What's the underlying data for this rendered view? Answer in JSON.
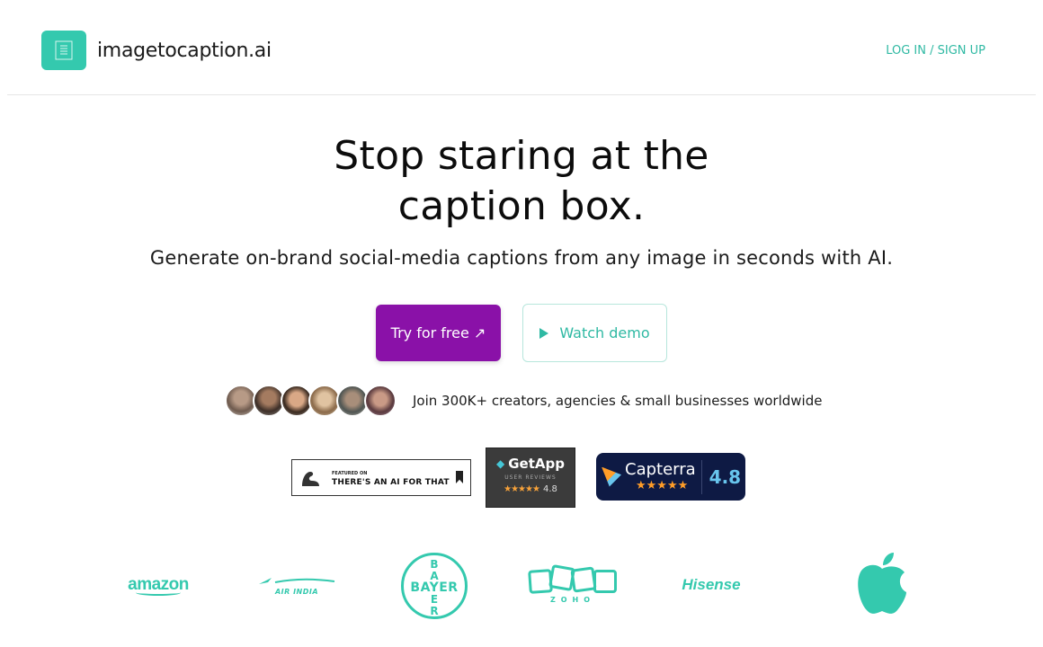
{
  "header": {
    "logo_text": "imagetocaption.ai",
    "auth_link": "LOG IN / SIGN UP"
  },
  "hero": {
    "title_line1": "Stop staring at the",
    "title_line2": "caption box.",
    "subtitle": "Generate on-brand social-media captions from any image in seconds with AI.",
    "primary_button": "Try for free ↗",
    "secondary_button": "Watch demo"
  },
  "social_proof": {
    "text": "Join 300K+ creators, agencies & small businesses worldwide",
    "avatar_count": 6
  },
  "badges": {
    "aift_small": "FEATURED ON",
    "aift_big": "THERE'S AN AI FOR THAT",
    "getapp_name": "GetApp",
    "getapp_sub": "USER REVIEWS",
    "getapp_rating": "4.8",
    "capterra_name": "Capterra",
    "capterra_rating": "4.8"
  },
  "brands": {
    "amazon": "amazon",
    "airindia_script": "एयर इंडिया",
    "airindia": "AIR INDIA",
    "bayer_vertical": [
      "B",
      "A",
      "Y",
      "E",
      "R"
    ],
    "bayer_horizontal": "BAYER",
    "zoho": "ZOHO",
    "hisense": "Hisense"
  },
  "colors": {
    "accent": "#34c9ae",
    "link": "#2fb9a3",
    "primary_button": "#8a11a8",
    "capterra_bg": "#0e1a44",
    "getapp_bg": "#3b3b3b"
  },
  "icons": {
    "logo": "document-lines-icon",
    "play": "play-icon",
    "apple": "apple-logo-icon"
  }
}
